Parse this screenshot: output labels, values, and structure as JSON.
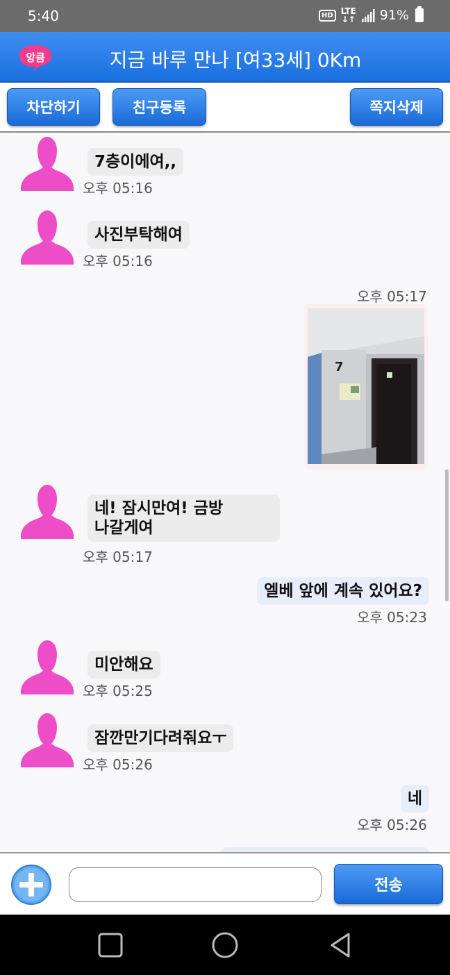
{
  "status": {
    "time": "5:40",
    "hd": "HD",
    "lte": "LTE",
    "battery": "91%"
  },
  "header": {
    "logo_text": "앙큼",
    "title": "지금 바루 만나 [여33세] 0Km"
  },
  "actions": {
    "block": "차단하기",
    "add_friend": "친구등록",
    "delete_message": "쪽지삭제"
  },
  "messages": [
    {
      "from": "them",
      "text": "7층이에여,,",
      "time": "오후 05:16"
    },
    {
      "from": "them",
      "text": "사진부탁해여",
      "time": "오후 05:16"
    },
    {
      "from": "me",
      "type": "image",
      "time": "오후 05:17",
      "image_label": "7"
    },
    {
      "from": "them",
      "text_line1": "네! 잠시만여!  금방",
      "text_line2": "나갈게여",
      "time": "오후 05:17"
    },
    {
      "from": "me",
      "text": "엘베 앞에 계속 있어요?",
      "time": "오후 05:23"
    },
    {
      "from": "them",
      "text": "미안해요",
      "time": "오후 05:25"
    },
    {
      "from": "them",
      "text": "잠깐만기다려줘요ㅜ",
      "time": "오후 05:26"
    },
    {
      "from": "me",
      "text": "네",
      "time": "오후 05:26"
    }
  ],
  "composer": {
    "placeholder": "",
    "send_label": "전송"
  },
  "icons": {
    "avatar": "female-avatar-icon",
    "plus": "plus-icon",
    "nav_recent": "square-icon",
    "nav_home": "circle-icon",
    "nav_back": "triangle-back-icon"
  },
  "colors": {
    "primary": "#1a6fe0",
    "avatar": "#ee4dc8",
    "my_bubble": "#e8eef9",
    "their_bubble": "#ececec"
  }
}
